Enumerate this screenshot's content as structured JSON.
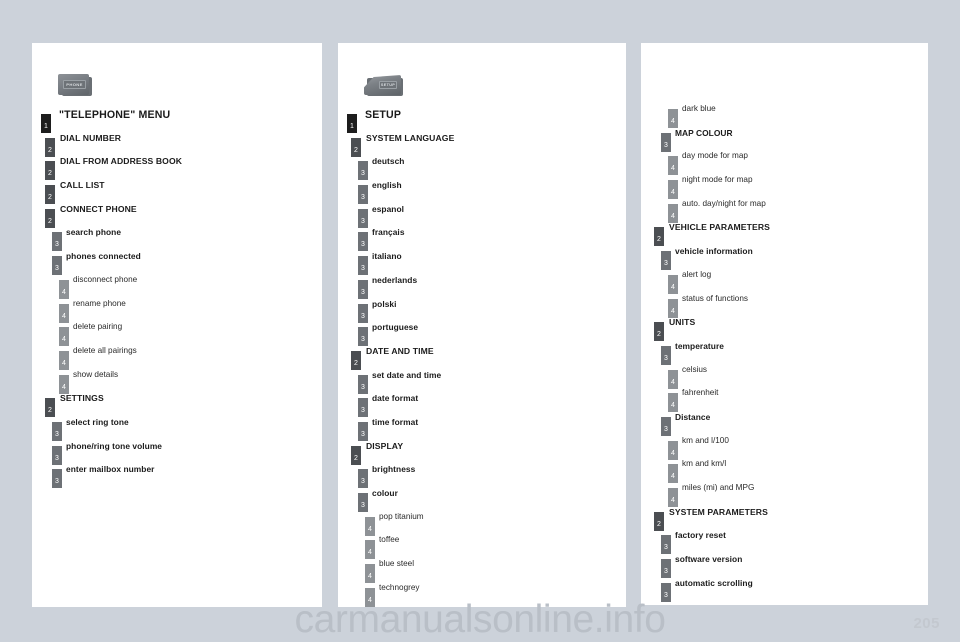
{
  "page": {
    "watermark": "carmanualsonline.info",
    "page_number": "205",
    "background_color": "#ccd2da",
    "panel_color": "#ffffff",
    "badge_colors": {
      "level1": "#1d1d1d",
      "level2": "#4b4e52",
      "level3": "#6d7176",
      "level4": "#8e9296"
    }
  },
  "columns": [
    {
      "id": "telephone-menu",
      "icon": {
        "name": "phone-button-icon",
        "caption": "PHONE"
      },
      "rows": [
        {
          "level": 1,
          "label": "\"TELEPHONE\" MENU"
        },
        {
          "level": 2,
          "label": "DIAL NUMBER"
        },
        {
          "level": 2,
          "label": "DIAL FROM ADDRESS BOOK"
        },
        {
          "level": 2,
          "label": "CALL LIST"
        },
        {
          "level": 2,
          "label": "CONNECT PHONE"
        },
        {
          "level": 3,
          "label": "search phone"
        },
        {
          "level": 3,
          "label": "phones connected"
        },
        {
          "level": 4,
          "label": "disconnect phone"
        },
        {
          "level": 4,
          "label": "rename phone"
        },
        {
          "level": 4,
          "label": "delete pairing"
        },
        {
          "level": 4,
          "label": "delete all pairings"
        },
        {
          "level": 4,
          "label": "show details"
        },
        {
          "level": 2,
          "label": "SETTINGS"
        },
        {
          "level": 3,
          "label": "select ring tone"
        },
        {
          "level": 3,
          "label": "phone/ring tone volume"
        },
        {
          "level": 3,
          "label": "enter mailbox number"
        }
      ]
    },
    {
      "id": "setup-menu",
      "icon": {
        "name": "setup-button-icon",
        "caption": "SETUP"
      },
      "rows": [
        {
          "level": 1,
          "label": "SETUP"
        },
        {
          "level": 2,
          "label": "SYSTEM LANGUAGE"
        },
        {
          "level": 3,
          "label": "deutsch"
        },
        {
          "level": 3,
          "label": "english"
        },
        {
          "level": 3,
          "label": "espanol"
        },
        {
          "level": 3,
          "label": "français"
        },
        {
          "level": 3,
          "label": "italiano"
        },
        {
          "level": 3,
          "label": "nederlands"
        },
        {
          "level": 3,
          "label": "polski"
        },
        {
          "level": 3,
          "label": "portuguese"
        },
        {
          "level": 2,
          "label": "DATE AND TIME"
        },
        {
          "level": 3,
          "label": "set date and time"
        },
        {
          "level": 3,
          "label": "date format"
        },
        {
          "level": 3,
          "label": "time format"
        },
        {
          "level": 2,
          "label": "DISPLAY"
        },
        {
          "level": 3,
          "label": "brightness"
        },
        {
          "level": 3,
          "label": "colour"
        },
        {
          "level": 4,
          "label": "pop titanium"
        },
        {
          "level": 4,
          "label": "toffee"
        },
        {
          "level": 4,
          "label": "blue steel"
        },
        {
          "level": 4,
          "label": "technogrey"
        }
      ]
    },
    {
      "id": "setup-menu-continued",
      "icon": null,
      "rows": [
        {
          "level": 4,
          "label": "dark blue"
        },
        {
          "level": 3,
          "label": "MAP COLOUR"
        },
        {
          "level": 4,
          "label": "day mode for map"
        },
        {
          "level": 4,
          "label": "night mode for map"
        },
        {
          "level": 4,
          "label": "auto. day/night for map"
        },
        {
          "level": 2,
          "label": "VEHICLE PARAMETERS"
        },
        {
          "level": 3,
          "label": "vehicle information"
        },
        {
          "level": 4,
          "label": "alert log"
        },
        {
          "level": 4,
          "label": "status of functions"
        },
        {
          "level": 2,
          "label": "UNITS"
        },
        {
          "level": 3,
          "label": "temperature"
        },
        {
          "level": 4,
          "label": "celsius"
        },
        {
          "level": 4,
          "label": "fahrenheit"
        },
        {
          "level": 3,
          "label": "Distance"
        },
        {
          "level": 4,
          "label": "km and l/100"
        },
        {
          "level": 4,
          "label": "km and km/l"
        },
        {
          "level": 4,
          "label": "miles (mi) and MPG"
        },
        {
          "level": 2,
          "label": "SYSTEM PARAMETERS"
        },
        {
          "level": 3,
          "label": "factory reset"
        },
        {
          "level": 3,
          "label": "software version"
        },
        {
          "level": 3,
          "label": "automatic scrolling"
        }
      ]
    }
  ]
}
